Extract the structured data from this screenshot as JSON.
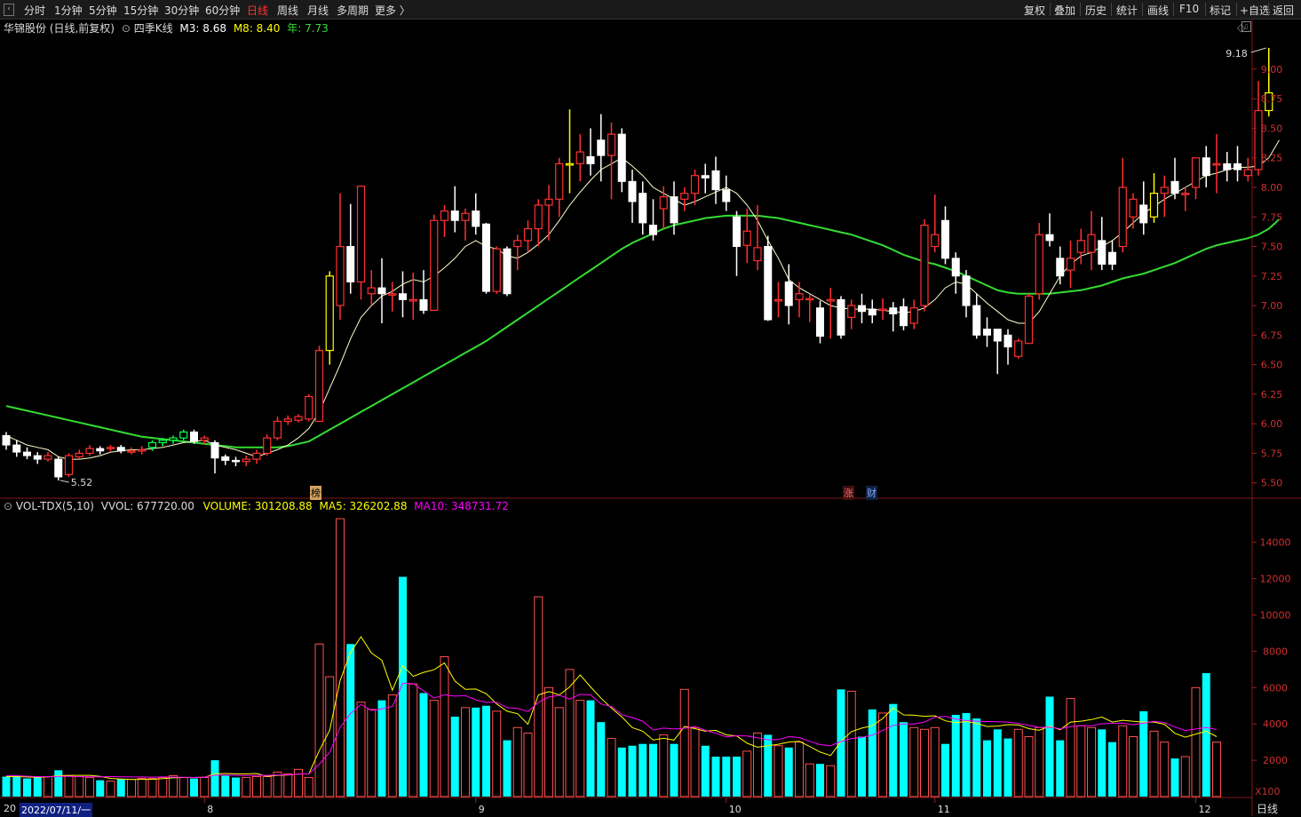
{
  "toolbar": {
    "periods": [
      "分时",
      "1分钟",
      "5分钟",
      "15分钟",
      "30分钟",
      "60分钟",
      "日线",
      "周线",
      "月线",
      "多周期",
      "更多 〉"
    ],
    "active_period": "日线",
    "actions": [
      "复权",
      "叠加",
      "历史",
      "统计",
      "画线",
      "F10",
      "标记",
      "+自选",
      "返回"
    ]
  },
  "header": {
    "stock": "华锦股份 (日线,前复权)",
    "indicator_name": "四季K线",
    "m3": "M3: 8.68",
    "m8": "M8: 8.40",
    "year": "年: 7.73"
  },
  "volume_header": {
    "name": "VOL-TDX(5,10)",
    "vvol": "VVOL: 677720.00",
    "volume": "VOLUME: 301208.88",
    "ma5": "MA5: 326202.88",
    "ma10": "MA10: 348731.72"
  },
  "markers": {
    "bang": "榜",
    "zhang": "涨",
    "cai": "财"
  },
  "colors": {
    "up": "#ff3030",
    "down": "#ffffff",
    "cyan": "#00ffff",
    "green_line": "#33dd33",
    "yellow": "#ffff00",
    "magenta": "#ff00ff",
    "axis": "#a02020"
  },
  "bottom": {
    "period": "日线",
    "date": "2022/07/11/一",
    "x100": "X100",
    "start_label": "20"
  },
  "chart_data": {
    "type": "candlestick",
    "price_axis": {
      "ticks": [
        "9.00",
        "8.75",
        "8.50",
        "8.25",
        "8.00",
        "7.75",
        "7.50",
        "7.25",
        "7.00",
        "6.75",
        "6.50",
        "6.25",
        "6.00",
        "5.75",
        "5.50"
      ],
      "range": [
        5.4,
        9.3
      ]
    },
    "volume_axis": {
      "ticks": [
        "14000",
        "12000",
        "10000",
        "8000",
        "6000",
        "4000",
        "2000"
      ],
      "range": [
        0,
        15500
      ],
      "unit": "X100"
    },
    "high_label": "9.18",
    "low_label": "5.52",
    "month_labels": [
      "8",
      "9",
      "10",
      "11",
      "12"
    ],
    "candles": [
      [
        5.9,
        5.82,
        5.93,
        5.78
      ],
      [
        5.82,
        5.76,
        5.86,
        5.72
      ],
      [
        5.76,
        5.73,
        5.8,
        5.7
      ],
      [
        5.73,
        5.7,
        5.76,
        5.66
      ],
      [
        5.7,
        5.73,
        5.76,
        5.68
      ],
      [
        5.7,
        5.55,
        5.72,
        5.52
      ],
      [
        5.57,
        5.73,
        5.75,
        5.55
      ],
      [
        5.72,
        5.75,
        5.78,
        5.7
      ],
      [
        5.75,
        5.79,
        5.82,
        5.73
      ],
      [
        5.79,
        5.77,
        5.81,
        5.74
      ],
      [
        5.79,
        5.8,
        5.82,
        5.76
      ],
      [
        5.8,
        5.77,
        5.82,
        5.75
      ],
      [
        5.77,
        5.77,
        5.8,
        5.74
      ],
      [
        5.77,
        5.78,
        5.81,
        5.74
      ],
      [
        5.8,
        5.84,
        5.86,
        5.77
      ],
      [
        5.84,
        5.86,
        5.88,
        5.81
      ],
      [
        5.86,
        5.88,
        5.9,
        5.83
      ],
      [
        5.88,
        5.93,
        5.95,
        5.86
      ],
      [
        5.93,
        5.85,
        5.95,
        5.83
      ],
      [
        5.86,
        5.88,
        5.9,
        5.83
      ],
      [
        5.84,
        5.71,
        5.86,
        5.58
      ],
      [
        5.72,
        5.69,
        5.74,
        5.65
      ],
      [
        5.69,
        5.68,
        5.72,
        5.64
      ],
      [
        5.68,
        5.7,
        5.73,
        5.64
      ],
      [
        5.7,
        5.75,
        5.78,
        5.66
      ],
      [
        5.75,
        5.88,
        5.91,
        5.73
      ],
      [
        5.88,
        6.02,
        6.06,
        5.86
      ],
      [
        6.02,
        6.04,
        6.07,
        5.99
      ],
      [
        6.03,
        6.06,
        6.08,
        6.01
      ],
      [
        6.04,
        6.23,
        6.25,
        6.02
      ],
      [
        6.02,
        6.62,
        6.66,
        6.02
      ],
      [
        6.62,
        7.25,
        7.29,
        6.5
      ],
      [
        7.0,
        7.5,
        7.95,
        6.88
      ],
      [
        7.5,
        7.2,
        7.86,
        7.1
      ],
      [
        7.2,
        8.01,
        8.01,
        7.05
      ],
      [
        7.1,
        7.15,
        7.3,
        7.0
      ],
      [
        7.15,
        7.1,
        7.4,
        6.85
      ],
      [
        7.1,
        7.1,
        7.2,
        6.95
      ],
      [
        7.1,
        7.05,
        7.29,
        6.9
      ],
      [
        7.05,
        7.05,
        7.28,
        6.88
      ],
      [
        7.05,
        6.96,
        7.3,
        6.93
      ],
      [
        6.96,
        7.72,
        7.77,
        6.96
      ],
      [
        7.72,
        7.8,
        7.85,
        7.58
      ],
      [
        7.8,
        7.72,
        8.01,
        7.62
      ],
      [
        7.72,
        7.78,
        7.82,
        7.55
      ],
      [
        7.8,
        7.67,
        7.95,
        7.6
      ],
      [
        7.69,
        7.12,
        7.7,
        7.1
      ],
      [
        7.12,
        7.48,
        7.5,
        7.1
      ],
      [
        7.48,
        7.1,
        7.5,
        7.08
      ],
      [
        7.5,
        7.55,
        7.6,
        7.3
      ],
      [
        7.55,
        7.65,
        7.72,
        7.45
      ],
      [
        7.65,
        7.85,
        7.9,
        7.5
      ],
      [
        7.85,
        7.9,
        8.02,
        7.55
      ],
      [
        7.9,
        8.2,
        8.25,
        7.75
      ],
      [
        8.2,
        8.2,
        8.66,
        7.95
      ],
      [
        8.2,
        8.3,
        8.45,
        8.05
      ],
      [
        8.26,
        8.2,
        8.5,
        8.1
      ],
      [
        8.4,
        8.27,
        8.62,
        8.05
      ],
      [
        8.27,
        8.45,
        8.55,
        7.9
      ],
      [
        8.45,
        8.05,
        8.5,
        7.96
      ],
      [
        8.05,
        7.88,
        8.15,
        7.7
      ],
      [
        7.95,
        7.7,
        8.05,
        7.6
      ],
      [
        7.68,
        7.6,
        7.9,
        7.55
      ],
      [
        7.82,
        7.92,
        8.01,
        7.65
      ],
      [
        7.92,
        7.7,
        8.05,
        7.6
      ],
      [
        7.9,
        7.95,
        8.0,
        7.8
      ],
      [
        7.95,
        8.1,
        8.15,
        7.85
      ],
      [
        8.1,
        8.08,
        8.2,
        7.95
      ],
      [
        8.14,
        7.98,
        8.26,
        7.86
      ],
      [
        7.98,
        7.88,
        8.1,
        7.8
      ],
      [
        7.75,
        7.5,
        7.8,
        7.25
      ],
      [
        7.51,
        7.63,
        7.82,
        7.36
      ],
      [
        7.38,
        7.49,
        7.85,
        7.3
      ],
      [
        7.5,
        6.88,
        7.59,
        6.87
      ],
      [
        7.05,
        7.05,
        7.2,
        6.9
      ],
      [
        7.2,
        7.0,
        7.35,
        6.84
      ],
      [
        7.05,
        7.1,
        7.2,
        6.9
      ],
      [
        7.06,
        7.06,
        7.09,
        6.86
      ],
      [
        6.98,
        6.74,
        7.04,
        6.68
      ],
      [
        7.05,
        7.05,
        7.15,
        6.72
      ],
      [
        7.05,
        6.75,
        7.08,
        6.72
      ],
      [
        6.9,
        7.0,
        7.05,
        6.8
      ],
      [
        7.0,
        6.95,
        7.1,
        6.85
      ],
      [
        6.97,
        6.92,
        7.05,
        6.85
      ],
      [
        6.97,
        6.97,
        7.06,
        6.88
      ],
      [
        6.98,
        6.93,
        7.03,
        6.78
      ],
      [
        6.99,
        6.83,
        7.06,
        6.79
      ],
      [
        6.85,
        6.98,
        7.05,
        6.8
      ],
      [
        7.0,
        7.68,
        7.73,
        6.95
      ],
      [
        7.5,
        7.6,
        7.94,
        7.45
      ],
      [
        7.72,
        7.4,
        7.84,
        7.35
      ],
      [
        7.4,
        7.25,
        7.45,
        7.1
      ],
      [
        7.25,
        7.0,
        7.3,
        6.9
      ],
      [
        7.0,
        6.75,
        7.1,
        6.72
      ],
      [
        6.8,
        6.75,
        6.9,
        6.65
      ],
      [
        6.8,
        6.7,
        6.8,
        6.42
      ],
      [
        6.75,
        6.65,
        6.8,
        6.5
      ],
      [
        6.57,
        6.7,
        6.72,
        6.55
      ],
      [
        6.68,
        7.08,
        7.1,
        6.68
      ],
      [
        7.1,
        7.6,
        7.7,
        7.05
      ],
      [
        7.6,
        7.55,
        7.78,
        7.5
      ],
      [
        7.4,
        7.25,
        7.5,
        7.18
      ],
      [
        7.3,
        7.4,
        7.55,
        7.15
      ],
      [
        7.45,
        7.55,
        7.65,
        7.35
      ],
      [
        7.45,
        7.6,
        7.8,
        7.3
      ],
      [
        7.55,
        7.35,
        7.75,
        7.3
      ],
      [
        7.45,
        7.35,
        7.55,
        7.3
      ],
      [
        7.5,
        8.0,
        8.25,
        7.45
      ],
      [
        7.75,
        7.9,
        7.95,
        7.65
      ],
      [
        7.85,
        7.7,
        8.05,
        7.6
      ],
      [
        7.75,
        7.95,
        8.12,
        7.7
      ],
      [
        7.95,
        8.0,
        8.1,
        7.75
      ],
      [
        8.05,
        7.95,
        8.25,
        7.9
      ],
      [
        7.95,
        7.95,
        8.0,
        7.8
      ],
      [
        8.0,
        8.25,
        8.25,
        7.9
      ],
      [
        8.25,
        8.1,
        8.35,
        8.0
      ],
      [
        8.2,
        8.2,
        8.45,
        7.95
      ],
      [
        8.2,
        8.15,
        8.3,
        8.05
      ],
      [
        8.2,
        8.15,
        8.35,
        8.05
      ],
      [
        8.1,
        8.15,
        8.25,
        8.05
      ],
      [
        8.15,
        8.65,
        8.9,
        8.1
      ],
      [
        8.65,
        8.8,
        9.18,
        8.6
      ]
    ],
    "volume_bars": [
      1100,
      1150,
      1000,
      1050,
      1100,
      1450,
      1150,
      1100,
      1050,
      900,
      850,
      950,
      950,
      1000,
      1000,
      1050,
      1150,
      1050,
      1000,
      1050,
      2000,
      1150,
      1050,
      1050,
      1100,
      1100,
      1350,
      1250,
      1500,
      1050,
      8400,
      6600,
      15300,
      8400,
      5200,
      4800,
      5300,
      5600,
      12100,
      6200,
      5700,
      5300,
      7700,
      4400,
      4900,
      4900,
      5000,
      4700,
      3100,
      3800,
      3500,
      11000,
      6000,
      4900,
      7000,
      5300,
      5300,
      4100,
      3200,
      2700,
      2800,
      2900,
      2900,
      3400,
      2900,
      5900,
      3800,
      2800,
      2200,
      2200,
      2200,
      2500,
      3500,
      3400,
      2800,
      2700,
      3000,
      1800,
      1800,
      1700,
      5900,
      5800,
      3300,
      4800,
      4600,
      5100,
      4100,
      3800,
      3700,
      3800,
      2900,
      4500,
      4600,
      4300,
      3100,
      3700,
      3200,
      3700,
      3300,
      3800,
      5500,
      3100,
      5400,
      3900,
      3800,
      3700,
      3000,
      3900,
      3300,
      4700,
      3600,
      3000,
      2100,
      2200,
      6000,
      6800,
      3000
    ],
    "ma5_series": [
      1100,
      1100,
      1080,
      1060,
      1080,
      1150,
      1170,
      1170,
      1170,
      1110,
      1000,
      970,
      940,
      950,
      950,
      990,
      1030,
      1050,
      1050,
      1060,
      1250,
      1270,
      1250,
      1250,
      1270,
      1110,
      1170,
      1190,
      1240,
      1250,
      2530,
      3660,
      6390,
      7940,
      8800,
      7900,
      7500,
      5860,
      7200,
      6620,
      6840,
      6980,
      7360,
      6360,
      5900,
      5920,
      5660,
      5100,
      4700,
      4560,
      3980,
      5600,
      5780,
      5600,
      6040,
      6700,
      6040,
      5420,
      4880,
      4380,
      3800,
      3600,
      3120,
      3210,
      3110,
      3860,
      3740,
      3600,
      3650,
      3400,
      3340,
      2940,
      2720,
      2800,
      2880,
      3000,
      3040,
      2760,
      2450,
      2260,
      3040,
      3580,
      3770,
      3900,
      4300,
      4880,
      4500,
      4480,
      4420,
      4450,
      4170,
      4070,
      4130,
      4030,
      3860,
      3880,
      3960,
      3940,
      3740,
      3650,
      3880,
      3680,
      4100,
      4150,
      4240,
      4380,
      4100,
      4200,
      4140,
      4100,
      4100,
      3980,
      3480,
      3270,
      3440,
      3600,
      3300
    ],
    "ma10_series": [
      1150,
      1150,
      1120,
      1100,
      1090,
      1110,
      1110,
      1100,
      1090,
      1090,
      1100,
      1090,
      1080,
      1080,
      1070,
      1080,
      1070,
      1060,
      1050,
      1070,
      1180,
      1190,
      1170,
      1160,
      1170,
      1170,
      1190,
      1200,
      1240,
      1250,
      1780,
      2440,
      3810,
      4570,
      5070,
      4740,
      4830,
      4960,
      6240,
      6220,
      5820,
      5420,
      5610,
      5530,
      5560,
      5330,
      5190,
      5200,
      4900,
      4850,
      4680,
      5200,
      5480,
      5580,
      5370,
      5630,
      5600,
      5100,
      4960,
      4510,
      4350,
      4150,
      3660,
      3770,
      3720,
      3760,
      3850,
      3650,
      3480,
      3290,
      3350,
      3340,
      3230,
      3130,
      3140,
      3300,
      3250,
      3040,
      2860,
      2800,
      3030,
      3200,
      3260,
      3380,
      3650,
      3920,
      4000,
      4000,
      4100,
      4370,
      4420,
      4270,
      4180,
      4150,
      4130,
      4120,
      4100,
      4030,
      3920,
      3810,
      3830,
      3730,
      3860,
      3900,
      3900,
      4010,
      4030,
      4050,
      3960,
      4040,
      4150,
      4070,
      3830,
      3640,
      3720,
      3800,
      3690
    ],
    "ma_short": [
      5.9,
      5.86,
      5.82,
      5.8,
      5.78,
      5.72,
      5.7,
      5.7,
      5.71,
      5.73,
      5.76,
      5.77,
      5.78,
      5.78,
      5.79,
      5.8,
      5.82,
      5.84,
      5.85,
      5.86,
      5.82,
      5.8,
      5.78,
      5.75,
      5.72,
      5.75,
      5.78,
      5.82,
      5.88,
      5.96,
      6.1,
      6.3,
      6.5,
      6.72,
      6.9,
      7.0,
      7.08,
      7.12,
      7.18,
      7.22,
      7.2,
      7.25,
      7.32,
      7.4,
      7.5,
      7.55,
      7.5,
      7.48,
      7.42,
      7.4,
      7.45,
      7.52,
      7.6,
      7.72,
      7.85,
      7.96,
      8.06,
      8.15,
      8.2,
      8.25,
      8.18,
      8.1,
      8.0,
      7.95,
      7.9,
      7.85,
      7.88,
      7.92,
      7.96,
      8.0,
      7.95,
      7.85,
      7.72,
      7.55,
      7.4,
      7.22,
      7.15,
      7.1,
      7.05,
      7.0,
      6.98,
      6.97,
      6.97,
      6.97,
      6.96,
      6.95,
      6.94,
      6.95,
      6.98,
      7.05,
      7.15,
      7.2,
      7.18,
      7.1,
      7.02,
      6.95,
      6.88,
      6.85,
      6.85,
      6.95,
      7.1,
      7.25,
      7.35,
      7.42,
      7.45,
      7.5,
      7.55,
      7.62,
      7.7,
      7.78,
      7.84,
      7.9,
      7.95,
      8.0,
      8.05,
      8.1,
      8.12,
      8.15,
      8.17,
      8.17,
      8.18,
      8.25,
      8.4
    ],
    "ma_year": [
      6.15,
      6.13,
      6.11,
      6.09,
      6.07,
      6.05,
      6.03,
      6.01,
      5.99,
      5.97,
      5.95,
      5.93,
      5.91,
      5.89,
      5.88,
      5.87,
      5.86,
      5.85,
      5.84,
      5.83,
      5.82,
      5.81,
      5.8,
      5.8,
      5.8,
      5.8,
      5.8,
      5.81,
      5.83,
      5.85,
      5.9,
      5.95,
      6.0,
      6.05,
      6.1,
      6.15,
      6.2,
      6.25,
      6.3,
      6.35,
      6.4,
      6.45,
      6.5,
      6.55,
      6.6,
      6.65,
      6.7,
      6.76,
      6.82,
      6.88,
      6.94,
      7.0,
      7.06,
      7.12,
      7.18,
      7.24,
      7.3,
      7.36,
      7.42,
      7.48,
      7.53,
      7.57,
      7.61,
      7.65,
      7.68,
      7.7,
      7.72,
      7.74,
      7.75,
      7.76,
      7.76,
      7.76,
      7.76,
      7.75,
      7.74,
      7.72,
      7.7,
      7.68,
      7.66,
      7.64,
      7.62,
      7.6,
      7.57,
      7.54,
      7.51,
      7.47,
      7.43,
      7.4,
      7.37,
      7.35,
      7.32,
      7.29,
      7.25,
      7.21,
      7.17,
      7.13,
      7.11,
      7.1,
      7.1,
      7.1,
      7.1,
      7.11,
      7.12,
      7.13,
      7.15,
      7.17,
      7.2,
      7.23,
      7.25,
      7.27,
      7.3,
      7.33,
      7.36,
      7.4,
      7.44,
      7.48,
      7.51,
      7.53,
      7.55,
      7.57,
      7.6,
      7.65,
      7.73
    ]
  }
}
